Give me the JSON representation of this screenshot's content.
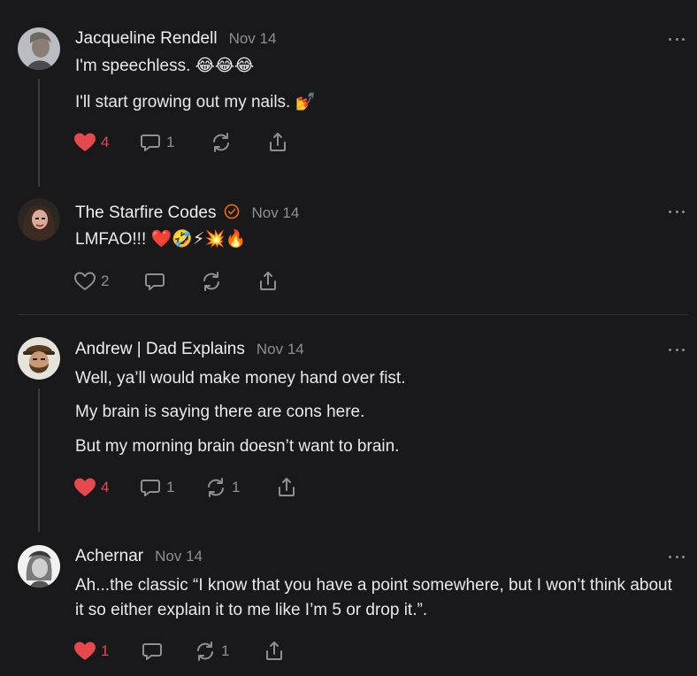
{
  "comments": [
    {
      "author": "Jacqueline Rendell",
      "date": "Nov 14",
      "lines": [
        "I'm speechless. 😂😂😂",
        "I'll start growing out my nails. 💅"
      ],
      "likes": "4",
      "liked": true,
      "replies": "1",
      "restacks": ""
    },
    {
      "author": "The Starfire Codes",
      "date": "Nov 14",
      "verified": true,
      "lines": [
        "LMFAO!!! ❤️🤣⚡💥🔥"
      ],
      "likes": "2",
      "liked": false,
      "replies": "",
      "restacks": ""
    },
    {
      "author": "Andrew | Dad Explains",
      "date": "Nov 14",
      "lines": [
        "Well, ya’ll would make money hand over fist.",
        "My brain is saying there are cons here.",
        "But my morning brain doesn’t want to brain."
      ],
      "likes": "4",
      "liked": true,
      "replies": "1",
      "restacks": "1"
    },
    {
      "author": "Achernar",
      "date": "Nov 14",
      "lines": [
        "Ah...the classic “I know that you have a point somewhere, but I won’t think about it so either explain it to me like I’m 5 or drop it.”."
      ],
      "likes": "1",
      "liked": true,
      "replies": "",
      "restacks": "1"
    }
  ],
  "colors": {
    "background": "#19191b",
    "like_active": "#e5484d",
    "verified_badge": "#f06a1a",
    "muted": "#8e8e93"
  }
}
